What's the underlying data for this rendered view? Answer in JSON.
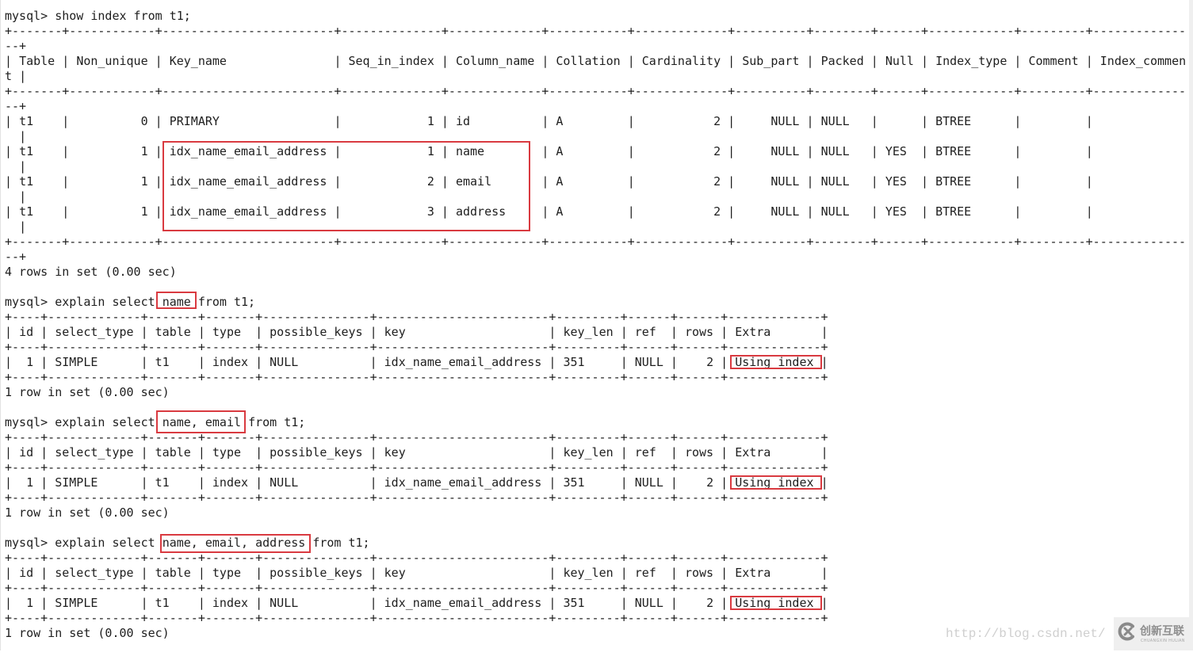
{
  "terminal": {
    "prompt": "mysql>"
  },
  "show_index": {
    "command": "show index from t1;",
    "columns": [
      "Table",
      "Non_unique",
      "Key_name",
      "Seq_in_index",
      "Column_name",
      "Collation",
      "Cardinality",
      "Sub_part",
      "Packed",
      "Null",
      "Index_type",
      "Comment",
      "Index_comment"
    ],
    "rows": [
      [
        "t1",
        "0",
        "PRIMARY",
        "1",
        "id",
        "A",
        "2",
        "NULL",
        "NULL",
        "",
        "BTREE",
        "",
        ""
      ],
      [
        "t1",
        "1",
        "idx_name_email_address",
        "1",
        "name",
        "A",
        "2",
        "NULL",
        "NULL",
        "YES",
        "BTREE",
        "",
        ""
      ],
      [
        "t1",
        "1",
        "idx_name_email_address",
        "2",
        "email",
        "A",
        "2",
        "NULL",
        "NULL",
        "YES",
        "BTREE",
        "",
        ""
      ],
      [
        "t1",
        "1",
        "idx_name_email_address",
        "3",
        "address",
        "A",
        "2",
        "NULL",
        "NULL",
        "YES",
        "BTREE",
        "",
        ""
      ]
    ],
    "footer": "4 rows in set (0.00 sec)",
    "highlight": {
      "rows": [
        1,
        2,
        3
      ],
      "columns": [
        "Key_name",
        "Seq_in_index",
        "Column_name"
      ]
    }
  },
  "explains": [
    {
      "command_prefix": "explain select",
      "selected_columns": "name",
      "command_suffix": "from t1;",
      "columns": [
        "id",
        "select_type",
        "table",
        "type",
        "possible_keys",
        "key",
        "key_len",
        "ref",
        "rows",
        "Extra"
      ],
      "rows": [
        [
          "1",
          "SIMPLE",
          "t1",
          "index",
          "NULL",
          "idx_name_email_address",
          "351",
          "NULL",
          "2",
          "Using index"
        ]
      ],
      "footer": "1 row in set (0.00 sec)",
      "highlight_column": "Extra"
    },
    {
      "command_prefix": "explain select",
      "selected_columns": "name, email",
      "command_suffix": "from t1;",
      "columns": [
        "id",
        "select_type",
        "table",
        "type",
        "possible_keys",
        "key",
        "key_len",
        "ref",
        "rows",
        "Extra"
      ],
      "rows": [
        [
          "1",
          "SIMPLE",
          "t1",
          "index",
          "NULL",
          "idx_name_email_address",
          "351",
          "NULL",
          "2",
          "Using index"
        ]
      ],
      "footer": "1 row in set (0.00 sec)",
      "highlight_column": "Extra"
    },
    {
      "command_prefix": "explain select",
      "selected_columns": "name, email, address",
      "command_suffix": "from t1;",
      "columns": [
        "id",
        "select_type",
        "table",
        "type",
        "possible_keys",
        "key",
        "key_len",
        "ref",
        "rows",
        "Extra"
      ],
      "rows": [
        [
          "1",
          "SIMPLE",
          "t1",
          "index",
          "NULL",
          "idx_name_email_address",
          "351",
          "NULL",
          "2",
          "Using index"
        ]
      ],
      "footer": "1 row in set (0.00 sec)",
      "highlight_column": "Extra"
    }
  ],
  "watermark": {
    "url": "http://blog.csdn.net/",
    "logo_icon": "circle-x-icon",
    "logo_text": "创新互联",
    "logo_subtext": "CHUANGXIN HULIAN"
  },
  "colors": {
    "background": "#ffffff",
    "text": "#1e1e1e",
    "highlight": "#d93a40",
    "watermark": "#cfcfcf"
  }
}
